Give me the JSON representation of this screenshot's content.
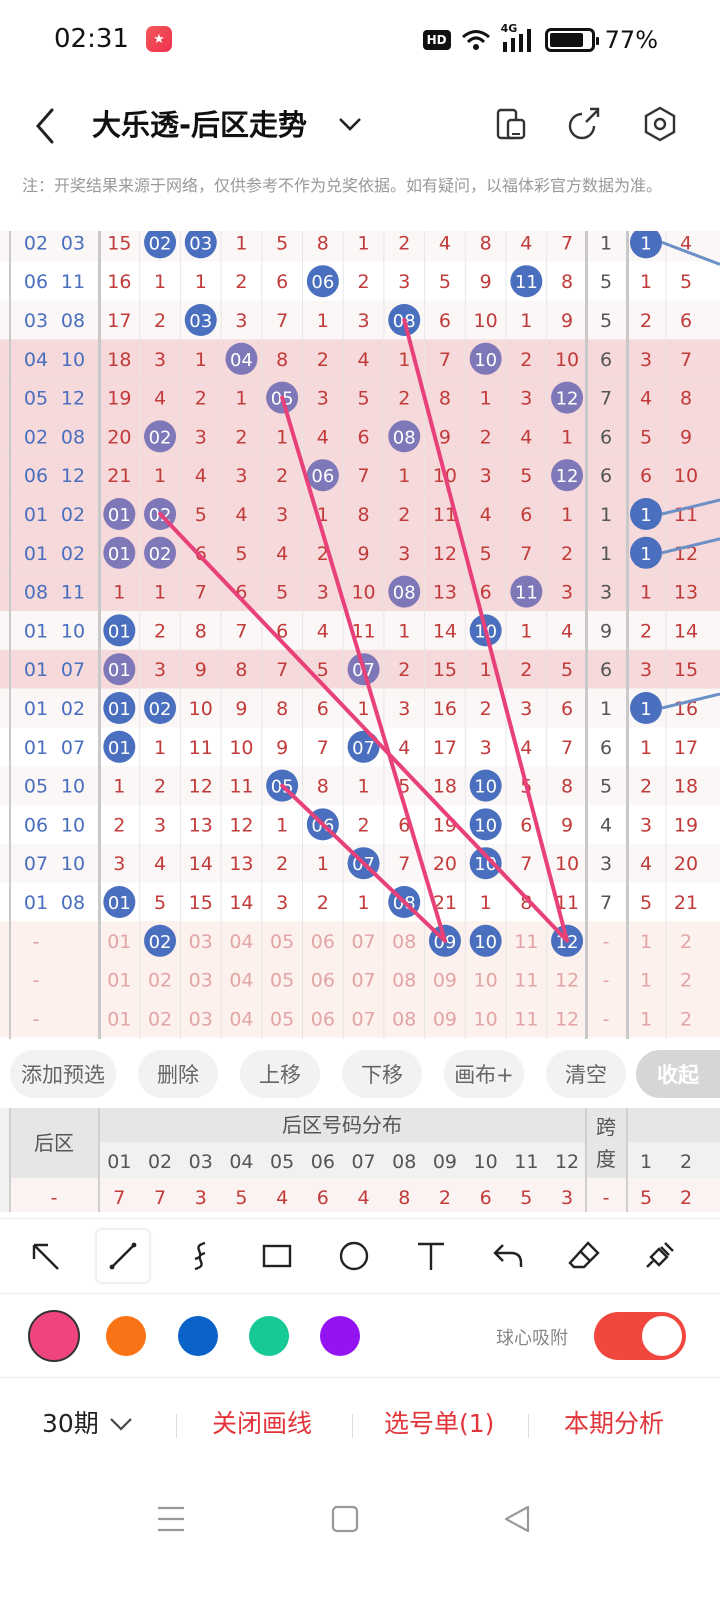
{
  "status": {
    "time": "02:31",
    "hd": "HD",
    "net": "4G",
    "battery": "77%"
  },
  "header": {
    "title": "大乐透-后区走势"
  },
  "note": "注：开奖结果来源于网络，仅供参考不作为兑奖依据。如有疑问，以福体彩官方数据为准。",
  "grid_rows": [
    {
      "pair": [
        "02",
        "03"
      ],
      "cells": [
        15,
        "02",
        "03",
        1,
        5,
        8,
        1,
        2,
        4,
        8,
        4,
        7
      ],
      "span": 1,
      "r": [
        "1",
        4
      ],
      "bg": "w"
    },
    {
      "pair": [
        "06",
        "11"
      ],
      "cells": [
        16,
        1,
        1,
        2,
        6,
        "06",
        2,
        3,
        5,
        9,
        "11",
        8
      ],
      "span": 5,
      "r": [
        1,
        5
      ],
      "bg": "w"
    },
    {
      "pair": [
        "03",
        "08"
      ],
      "cells": [
        17,
        2,
        "03",
        3,
        7,
        1,
        3,
        "08",
        6,
        10,
        1,
        9
      ],
      "span": 5,
      "r": [
        2,
        6
      ],
      "bg": "w"
    },
    {
      "pair": [
        "04",
        "10"
      ],
      "cells": [
        18,
        3,
        1,
        "04",
        8,
        2,
        4,
        1,
        7,
        "10",
        2,
        10
      ],
      "span": 6,
      "r": [
        3,
        7
      ],
      "bg": "p"
    },
    {
      "pair": [
        "05",
        "12"
      ],
      "cells": [
        19,
        4,
        2,
        1,
        "05",
        3,
        5,
        2,
        8,
        1,
        3,
        "12"
      ],
      "span": 7,
      "r": [
        4,
        8
      ],
      "bg": "p"
    },
    {
      "pair": [
        "02",
        "08"
      ],
      "cells": [
        20,
        "02",
        3,
        2,
        1,
        4,
        6,
        "08",
        9,
        2,
        4,
        1
      ],
      "span": 6,
      "r": [
        5,
        9
      ],
      "bg": "p"
    },
    {
      "pair": [
        "06",
        "12"
      ],
      "cells": [
        21,
        1,
        4,
        3,
        2,
        "06",
        7,
        1,
        10,
        3,
        5,
        "12"
      ],
      "span": 6,
      "r": [
        6,
        10
      ],
      "bg": "p"
    },
    {
      "pair": [
        "01",
        "02"
      ],
      "cells": [
        "01",
        "02",
        5,
        4,
        3,
        1,
        8,
        2,
        11,
        4,
        6,
        1
      ],
      "span": 1,
      "r": [
        "1",
        11
      ],
      "bg": "p"
    },
    {
      "pair": [
        "01",
        "02"
      ],
      "cells": [
        "01",
        "02",
        6,
        5,
        4,
        2,
        9,
        3,
        12,
        5,
        7,
        2
      ],
      "span": 1,
      "r": [
        "1",
        12
      ],
      "bg": "p"
    },
    {
      "pair": [
        "08",
        "11"
      ],
      "cells": [
        1,
        1,
        7,
        6,
        5,
        3,
        10,
        "08",
        13,
        6,
        "11",
        3
      ],
      "span": 3,
      "r": [
        1,
        13
      ],
      "bg": "p"
    },
    {
      "pair": [
        "01",
        "10"
      ],
      "cells": [
        "01",
        2,
        8,
        7,
        6,
        4,
        11,
        1,
        14,
        "10",
        1,
        4
      ],
      "span": 9,
      "r": [
        2,
        14
      ],
      "bg": "w"
    },
    {
      "pair": [
        "01",
        "07"
      ],
      "cells": [
        "01",
        3,
        9,
        8,
        7,
        5,
        "07",
        2,
        15,
        1,
        2,
        5
      ],
      "span": 6,
      "r": [
        3,
        15
      ],
      "bg": "p"
    },
    {
      "pair": [
        "01",
        "02"
      ],
      "cells": [
        "01",
        "02",
        10,
        9,
        8,
        6,
        1,
        3,
        16,
        2,
        3,
        6
      ],
      "span": 1,
      "r": [
        "1",
        16
      ],
      "bg": "w"
    },
    {
      "pair": [
        "01",
        "07"
      ],
      "cells": [
        "01",
        1,
        11,
        10,
        9,
        7,
        "07",
        4,
        17,
        3,
        4,
        7
      ],
      "span": 6,
      "r": [
        1,
        17
      ],
      "bg": "w"
    },
    {
      "pair": [
        "05",
        "10"
      ],
      "cells": [
        1,
        2,
        12,
        11,
        "05",
        8,
        1,
        5,
        18,
        "10",
        5,
        8
      ],
      "span": 5,
      "r": [
        2,
        18
      ],
      "bg": "w"
    },
    {
      "pair": [
        "06",
        "10"
      ],
      "cells": [
        2,
        3,
        13,
        12,
        1,
        "06",
        2,
        6,
        19,
        "10",
        6,
        9
      ],
      "span": 4,
      "r": [
        3,
        19
      ],
      "bg": "w"
    },
    {
      "pair": [
        "07",
        "10"
      ],
      "cells": [
        3,
        4,
        14,
        13,
        2,
        1,
        "07",
        7,
        20,
        "10",
        7,
        10
      ],
      "span": 3,
      "r": [
        4,
        20
      ],
      "bg": "w"
    },
    {
      "pair": [
        "01",
        "08"
      ],
      "cells": [
        "01",
        5,
        15,
        14,
        3,
        2,
        1,
        "08",
        21,
        1,
        8,
        11
      ],
      "span": 7,
      "r": [
        5,
        21
      ],
      "bg": "w"
    },
    {
      "pair": [
        "-",
        ""
      ],
      "cells": [
        "01",
        "02",
        "03",
        "04",
        "05",
        "06",
        "07",
        "08",
        "09",
        "10",
        "11",
        "12"
      ],
      "span": "-",
      "r": [
        1,
        2
      ],
      "bg": "f",
      "sel": [
        "02",
        "09",
        "10",
        "12"
      ]
    },
    {
      "pair": [
        "-",
        ""
      ],
      "cells": [
        "01",
        "02",
        "03",
        "04",
        "05",
        "06",
        "07",
        "08",
        "09",
        "10",
        "11",
        "12"
      ],
      "span": "-",
      "r": [
        1,
        2
      ],
      "bg": "f"
    },
    {
      "pair": [
        "-",
        ""
      ],
      "cells": [
        "01",
        "02",
        "03",
        "04",
        "05",
        "06",
        "07",
        "08",
        "09",
        "10",
        "11",
        "12"
      ],
      "span": "-",
      "r": [
        1,
        2
      ],
      "bg": "f"
    }
  ],
  "actions": [
    "添加预选",
    "删除",
    "上移",
    "下移",
    "画布+",
    "清空",
    "收起"
  ],
  "table_head": {
    "section": "后区",
    "dist_title": "后区号码分布",
    "span_label": "跨度",
    "numbers": [
      "01",
      "02",
      "03",
      "04",
      "05",
      "06",
      "07",
      "08",
      "09",
      "10",
      "11",
      "12"
    ],
    "extra_cols": [
      "1",
      "2"
    ],
    "counts_label": "-",
    "counts": [
      7,
      7,
      3,
      5,
      4,
      6,
      4,
      8,
      2,
      6,
      5,
      3
    ],
    "span_count": "-",
    "extra_counts": [
      5,
      2
    ]
  },
  "tools": [
    "arrow-tool-icon",
    "line-tool-icon",
    "curve-tool-icon",
    "rectangle-tool-icon",
    "circle-tool-icon",
    "text-tool-icon",
    "undo-icon",
    "eraser-icon",
    "clear-brush-icon"
  ],
  "colors": [
    "#f0457c",
    "#f97316",
    "#0b63c9",
    "#16c995",
    "#9314f0"
  ],
  "snap_label": "球心吸附",
  "bottom": {
    "period": "30期",
    "close_draw": "关闭画线",
    "pick_list": "选号单(1)",
    "analysis": "本期分析"
  },
  "colors_theme": {
    "ball_blue": "#4a6fbe",
    "ball_purple": "#7f78b8",
    "num_red": "#c23b3b",
    "draw_line": "#e8417a",
    "accent": "#e2353b"
  }
}
